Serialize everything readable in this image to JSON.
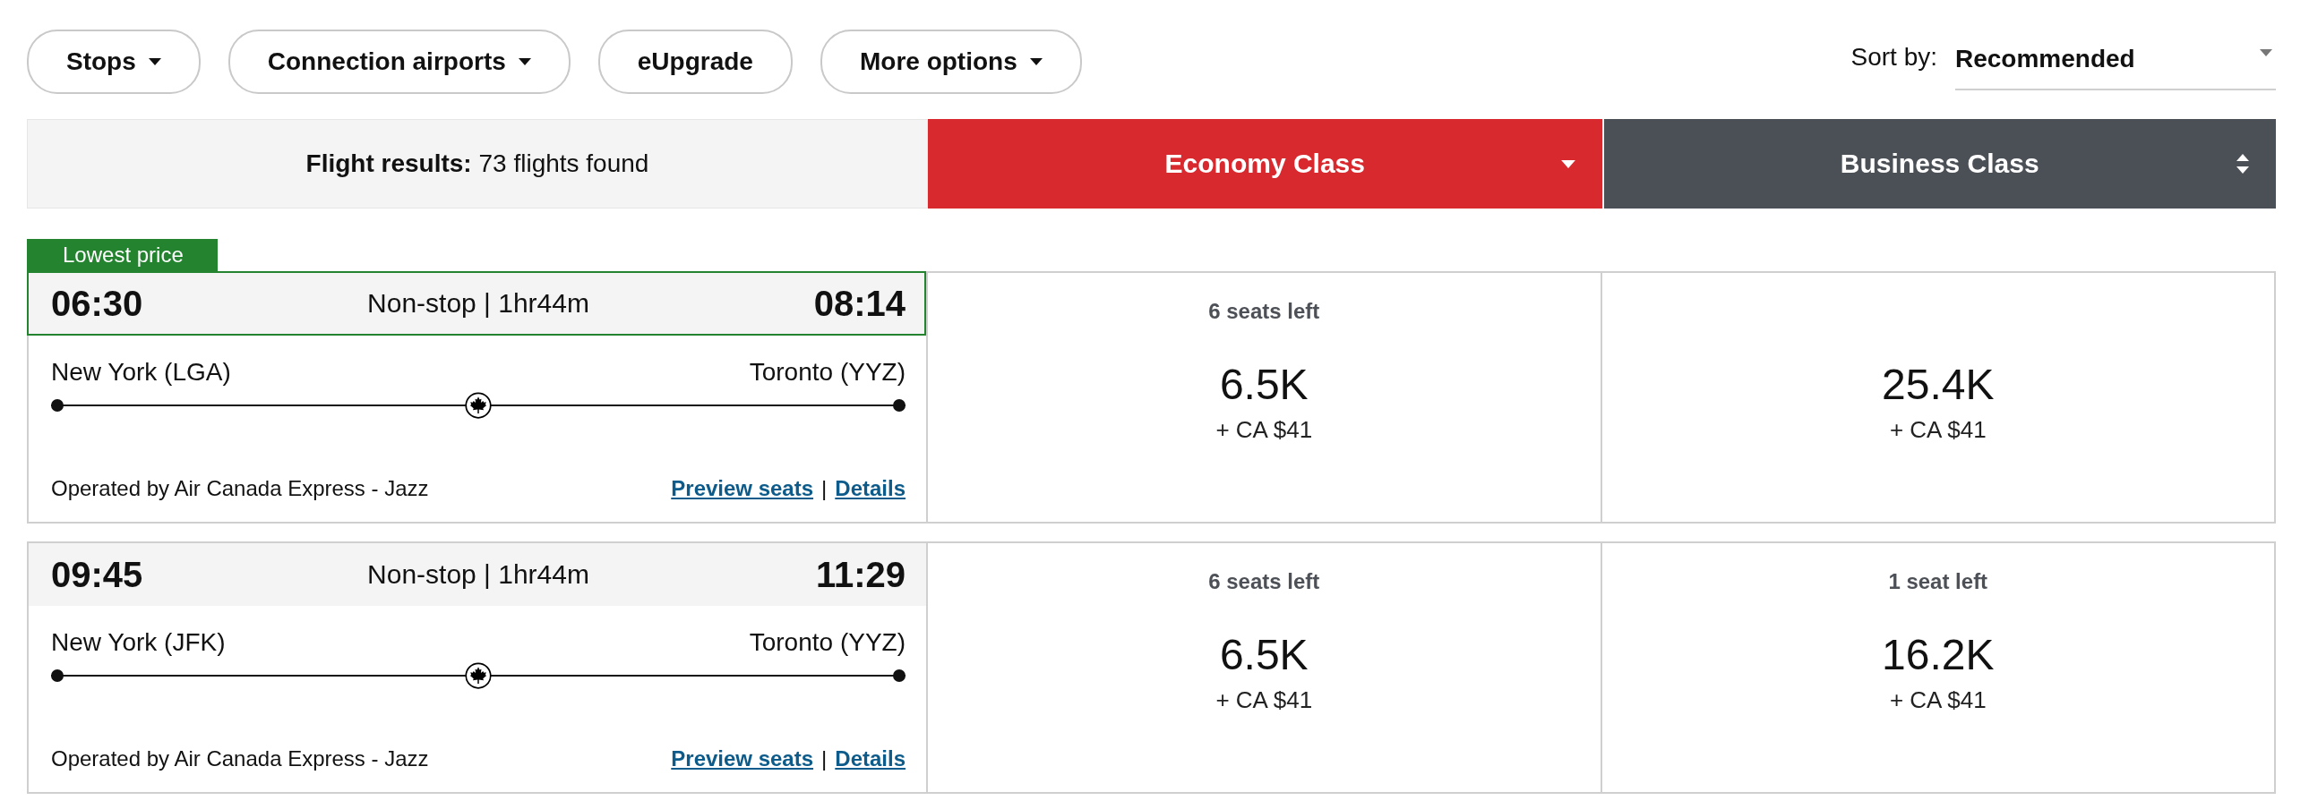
{
  "filters": [
    {
      "label": "Stops",
      "dropdown": true
    },
    {
      "label": "Connection airports",
      "dropdown": true
    },
    {
      "label": "eUpgrade",
      "dropdown": false
    },
    {
      "label": "More options",
      "dropdown": true
    }
  ],
  "sort": {
    "label": "Sort by:",
    "value": "Recommended"
  },
  "results_header": {
    "summary": "**Flight results:** 73 flights found",
    "cabins": [
      {
        "label": "Economy Class",
        "selected": true
      },
      {
        "label": "Business Class",
        "selected": false
      }
    ]
  },
  "flights": [
    {
      "badge": "Lowest price",
      "highlighted": true,
      "departure": "06:30",
      "duration": "Non-stop | 1hr44m",
      "arrival": "08:14",
      "origin": "New York (LGA)",
      "destination": "Toronto (YYZ)",
      "operator": "Operated by Air Canada Express - Jazz",
      "links": [
        "Preview seats",
        "Details"
      ],
      "link_separator": "|",
      "fares": [
        {
          "seats_left": "6 seats left",
          "price": "6.5K",
          "fee": "+ CA $41"
        },
        {
          "price": "25.4K",
          "fee": "+ CA $41"
        }
      ]
    },
    {
      "highlighted": false,
      "departure": "09:45",
      "duration": "Non-stop | 1hr44m",
      "arrival": "11:29",
      "origin": "New York (JFK)",
      "destination": "Toronto (YYZ)",
      "operator": "Operated by Air Canada Express - Jazz",
      "links": [
        "Preview seats",
        "Details"
      ],
      "link_separator": "|",
      "fares": [
        {
          "seats_left": "6 seats left",
          "price": "6.5K",
          "fee": "+ CA $41"
        },
        {
          "seats_left": "1 seat left",
          "price": "16.2K",
          "fee": "+ CA $41"
        }
      ]
    }
  ]
}
